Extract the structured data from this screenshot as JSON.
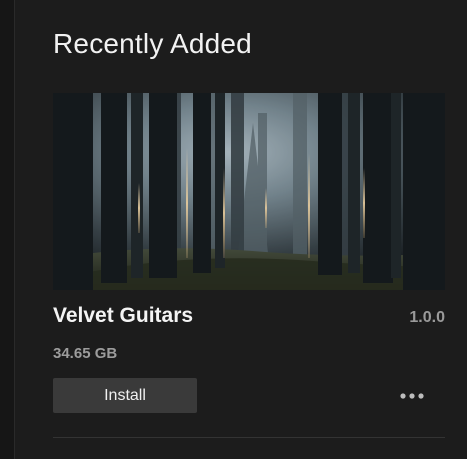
{
  "section": {
    "title": "Recently Added"
  },
  "product": {
    "artwork_icon": "foggy-forest-artwork",
    "name": "Velvet Guitars",
    "version": "1.0.0",
    "size": "34.65 GB",
    "install_label": "Install",
    "more_icon": "more-horizontal-icon"
  },
  "colors": {
    "background": "#1c1c1c",
    "button": "#3a3a3a",
    "text_primary": "#f2f2f2",
    "text_secondary": "#9a9a9a"
  }
}
